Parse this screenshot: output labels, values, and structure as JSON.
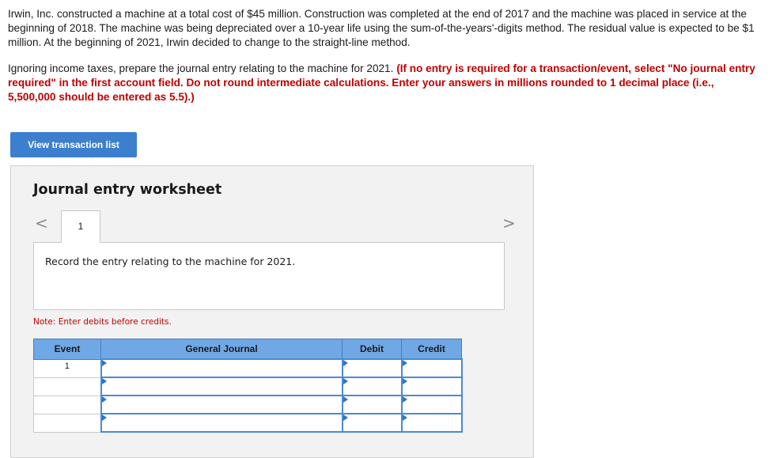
{
  "question": {
    "paragraph1": "Irwin, Inc. constructed a machine at a total cost of $45 million. Construction was completed at the end of 2017 and the machine was placed in service at the beginning of 2018. The machine was being depreciated over a 10-year life using the sum-of-the-years'-digits method. The residual value is expected to be $1 million. At the beginning of 2021, Irwin decided to change to the straight-line method.",
    "paragraph2_plain": "Ignoring income taxes, prepare the journal entry relating to the machine for 2021. ",
    "paragraph2_emphasis": "(If no entry is required for a transaction/event, select \"No journal entry required\" in the first account field. Do not round intermediate calculations. Enter your answers in millions rounded to 1 decimal place (i.e., 5,500,000 should be entered as 5.5).)"
  },
  "buttons": {
    "view_transaction_list": "View transaction list"
  },
  "worksheet": {
    "title": "Journal entry worksheet",
    "nav_prev": "<",
    "nav_next": ">",
    "active_tab": "1",
    "instruction": "Record the entry relating to the machine for 2021.",
    "note": "Note: Enter debits before credits.",
    "table": {
      "headers": [
        "Event",
        "General Journal",
        "Debit",
        "Credit"
      ],
      "rows": [
        {
          "event": "1",
          "account": "",
          "debit": "",
          "credit": ""
        },
        {
          "event": "",
          "account": "",
          "debit": "",
          "credit": ""
        },
        {
          "event": "",
          "account": "",
          "debit": "",
          "credit": ""
        },
        {
          "event": "",
          "account": "",
          "debit": "",
          "credit": ""
        }
      ]
    }
  },
  "colors": {
    "button_blue": "#3d7fcf",
    "header_blue": "#70a8e6",
    "emphasis_red": "#c00000",
    "input_border": "#4a8ad4"
  }
}
